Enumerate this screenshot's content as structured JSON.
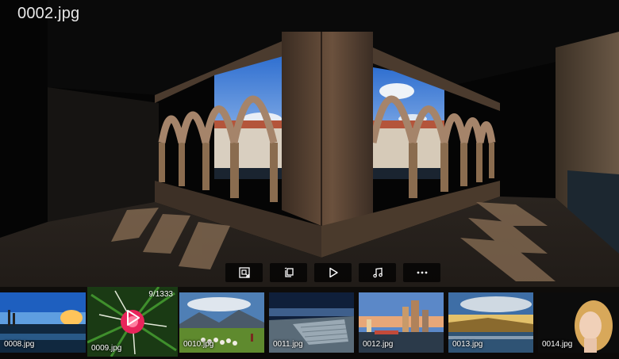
{
  "viewer": {
    "filename": "0002.jpg"
  },
  "toolbar": {
    "buttons": [
      {
        "name": "rotate-image-button",
        "icon": "image-rotate-icon"
      },
      {
        "name": "copy-button",
        "icon": "copy-icon"
      },
      {
        "name": "slideshow-button",
        "icon": "play-icon"
      },
      {
        "name": "music-button",
        "icon": "music-note-icon"
      },
      {
        "name": "more-options-button",
        "icon": "more-dots-icon"
      }
    ]
  },
  "filmstrip": {
    "counter": "9/1333",
    "items": [
      {
        "label": "0008.jpg"
      },
      {
        "label": "0009.jpg"
      },
      {
        "label": "0010.jpg"
      },
      {
        "label": "0011.jpg"
      },
      {
        "label": "0012.jpg"
      },
      {
        "label": "0013.jpg"
      },
      {
        "label": "0014.jpg"
      }
    ]
  }
}
